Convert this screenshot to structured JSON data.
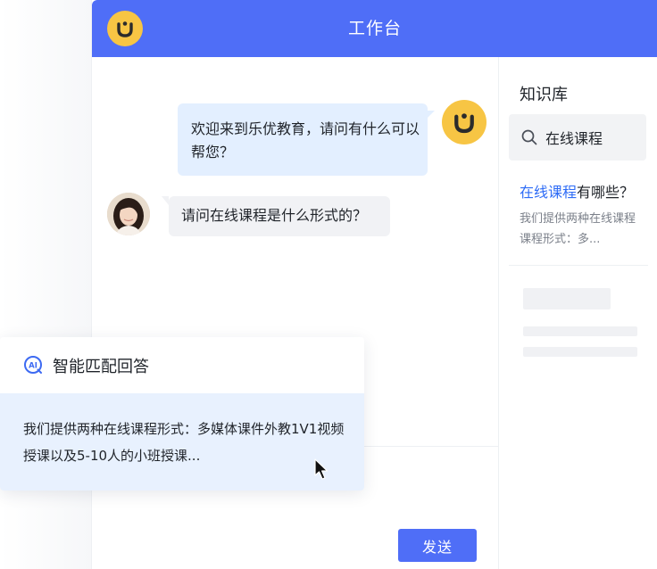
{
  "header": {
    "title": "工作台"
  },
  "chat": {
    "messages": [
      {
        "role": "bot",
        "text": "欢迎来到乐优教育，请问有什么可以帮您？"
      },
      {
        "role": "user",
        "text": "请问在线课程是什么形式的？"
      }
    ],
    "send_label": "发送"
  },
  "knowledge_base": {
    "title": "知识库",
    "search_value": "在线课程",
    "question_highlight": "在线课程",
    "question_rest": "有哪些？",
    "snippet": "我们提供两种在线课程课程形式：多..."
  },
  "smart_match": {
    "title": "智能匹配回答",
    "answer": "我们提供两种在线课程形式：多媒体课件外教1V1视频授课以及5-10人的小班授课..."
  },
  "colors": {
    "header_blue": "#4f6ef7",
    "logo_yellow": "#f7c544",
    "bot_bubble": "#e3efff",
    "highlight_blue": "#2e6cf6"
  }
}
